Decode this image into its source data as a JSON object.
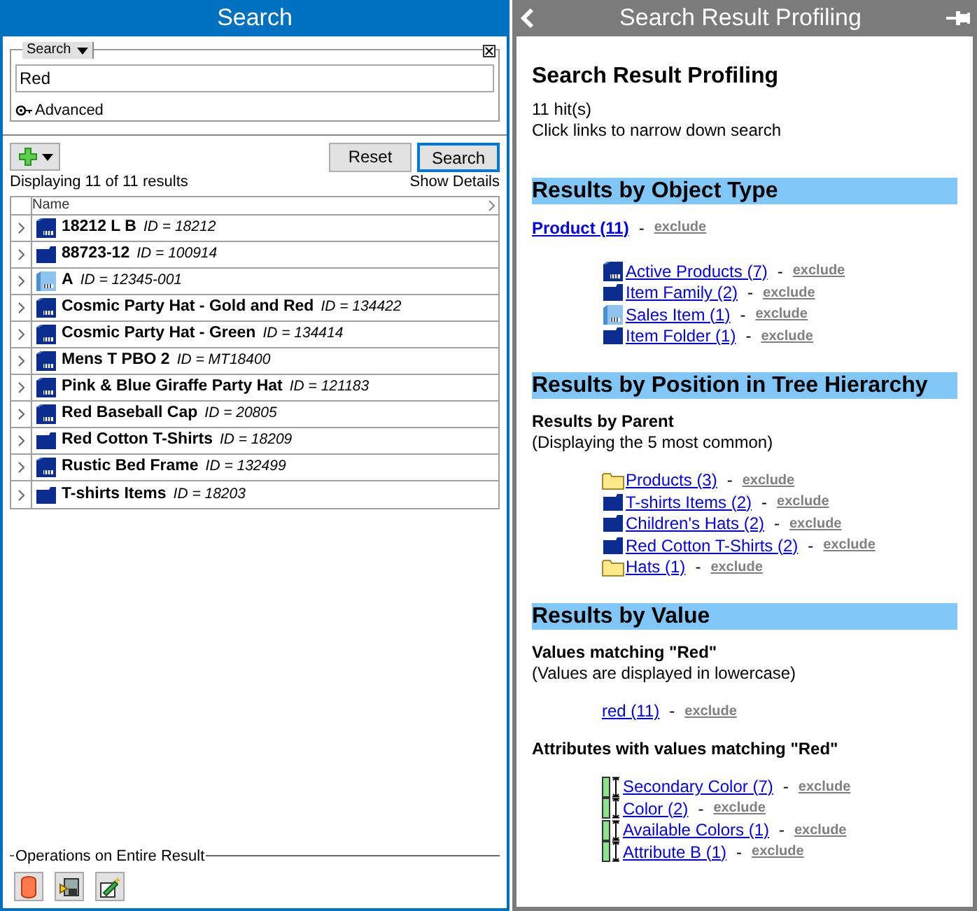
{
  "search_panel": {
    "title": "Search",
    "search_box": {
      "mode": "Search",
      "value": "Red",
      "advanced": "Advanced"
    },
    "buttons": [
      "Reset",
      "Search"
    ],
    "summary": "Displaying 11 of 11 results",
    "details_link": "Show Details",
    "table": {
      "columns": [
        "Name"
      ],
      "rows": [
        {
          "kind": "product",
          "name": "18212 L B",
          "id": "ID = 18212"
        },
        {
          "kind": "folder",
          "name": "88723-12",
          "id": "ID = 100914"
        },
        {
          "kind": "item",
          "name": "A",
          "id": "ID = 12345-001"
        },
        {
          "kind": "product",
          "name": "Cosmic Party Hat - Gold and Red",
          "id": "ID = 134422"
        },
        {
          "kind": "product",
          "name": "Cosmic Party Hat - Green",
          "id": "ID = 134414"
        },
        {
          "kind": "product",
          "name": "Mens T PBO 2",
          "id": "ID = MT18400"
        },
        {
          "kind": "product",
          "name": "Pink & Blue Giraffe Party Hat",
          "id": "ID = 121183"
        },
        {
          "kind": "product",
          "name": "Red Baseball Cap",
          "id": "ID = 20805"
        },
        {
          "kind": "folder",
          "name": "Red Cotton T-Shirts",
          "id": "ID = 18209"
        },
        {
          "kind": "product",
          "name": "Rustic Bed Frame",
          "id": "ID = 132499"
        },
        {
          "kind": "folder",
          "name": "T-shirts Items",
          "id": "ID = 18203"
        }
      ]
    },
    "operations": {
      "label": "Operations on Entire Result"
    }
  },
  "profiling_panel": {
    "title": "Search Result Profiling",
    "heading": "Search Result Profiling",
    "hits": "11 hit(s)",
    "hint": "Click links to narrow down search",
    "sections": [
      {
        "title": "Results by Object Type",
        "groups": [
          {
            "category": {
              "label": "Product (11)",
              "separator": "-",
              "exclude": "exclude",
              "children": [
                {
                  "kind": "product",
                  "label": "Active Products (7)",
                  "separator": "-",
                  "exclude": "exclude"
                },
                {
                  "kind": "folder",
                  "label": "Item Family (2)",
                  "separator": "-",
                  "exclude": "exclude"
                },
                {
                  "kind": "item",
                  "label": "Sales Item (1)",
                  "separator": "-",
                  "exclude": "exclude"
                },
                {
                  "kind": "folder",
                  "label": "Item Folder (1)",
                  "separator": "-",
                  "exclude": "exclude"
                }
              ]
            }
          }
        ]
      },
      {
        "title": "Results by Position in Tree Hierarchy",
        "groups": [
          {
            "label": "Results by Parent",
            "note": "(Displaying the 5 most common)",
            "links": [
              {
                "kind": "yellow-folder",
                "label": "Products (3)",
                "separator": "-",
                "exclude": "exclude"
              },
              {
                "kind": "folder",
                "label": "T-shirts Items (2)",
                "separator": "-",
                "exclude": "exclude"
              },
              {
                "kind": "folder",
                "label": "Children's Hats (2)",
                "separator": "-",
                "exclude": "exclude"
              },
              {
                "kind": "folder",
                "label": "Red Cotton T-Shirts (2)",
                "separator": "-",
                "exclude": "exclude"
              },
              {
                "kind": "yellow-folder",
                "label": "Hats (1)",
                "separator": "-",
                "exclude": "exclude"
              }
            ]
          }
        ]
      },
      {
        "title": "Results by Value",
        "groups": [
          {
            "label": "Values matching \"Red\"",
            "note": "(Values are displayed in lowercase)",
            "links": [
              {
                "kind": "plain",
                "label": "red (11)",
                "separator": "-",
                "exclude": "exclude"
              }
            ]
          },
          {
            "label": "Attributes with values matching \"Red\"",
            "links": [
              {
                "kind": "attribute",
                "label": "Secondary Color (7)",
                "separator": "-",
                "exclude": "exclude"
              },
              {
                "kind": "attribute",
                "label": "Color (2)",
                "separator": "-",
                "exclude": "exclude"
              },
              {
                "kind": "attribute",
                "label": "Available Colors (1)",
                "separator": "-",
                "exclude": "exclude"
              },
              {
                "kind": "attribute",
                "label": "Attribute B (1)",
                "separator": "-",
                "exclude": "exclude"
              }
            ]
          }
        ]
      }
    ]
  }
}
